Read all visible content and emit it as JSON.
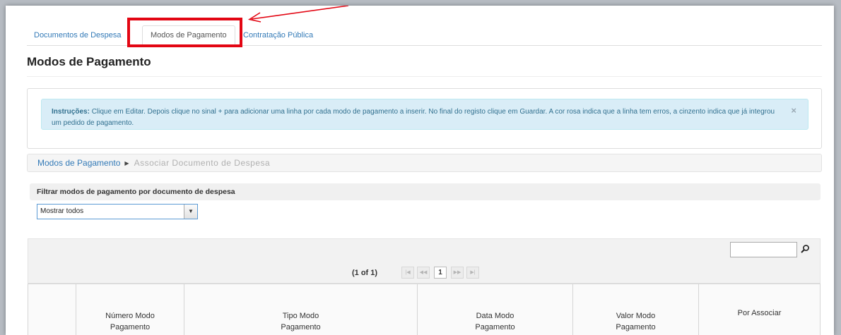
{
  "tabs": [
    {
      "label": "Documentos de Despesa"
    },
    {
      "label": "Modos de Pagamento"
    },
    {
      "label": "Contratação Pública"
    }
  ],
  "page_title": "Modos de Pagamento",
  "instructions": {
    "label": "Instruções:",
    "text": "Clique em Editar. Depois clique no sinal + para adicionar uma linha por cada modo de pagamento a inserir. No final do registo clique em Guardar. A cor rosa indica que a linha tem erros, a cinzento indica que já integrou um pedido de pagamento.",
    "close": "×"
  },
  "breadcrumb": {
    "items": [
      {
        "label": "Modos de Pagamento"
      },
      {
        "label": "Associar Documento de Despesa"
      }
    ],
    "separator": "▶"
  },
  "filter": {
    "heading": "Filtrar modos de pagamento por documento de despesa",
    "selected": "Mostrar todos"
  },
  "paginator": {
    "text": "(1 of 1)",
    "first": "|◀",
    "prev": "◀◀",
    "page": "1",
    "next": "▶▶",
    "last": "▶|"
  },
  "table": {
    "columns": [
      {
        "label": ""
      },
      {
        "label": "Número Modo\nPagamento"
      },
      {
        "label": "Tipo Modo\nPagamento"
      },
      {
        "label": "Data Modo\nPagamento"
      },
      {
        "label": "Valor Modo\nPagamento"
      },
      {
        "label": "Por Associar"
      }
    ]
  },
  "colors": {
    "highlight": "#e30613",
    "link": "#337ab7",
    "alert_bg": "#d9edf7"
  }
}
